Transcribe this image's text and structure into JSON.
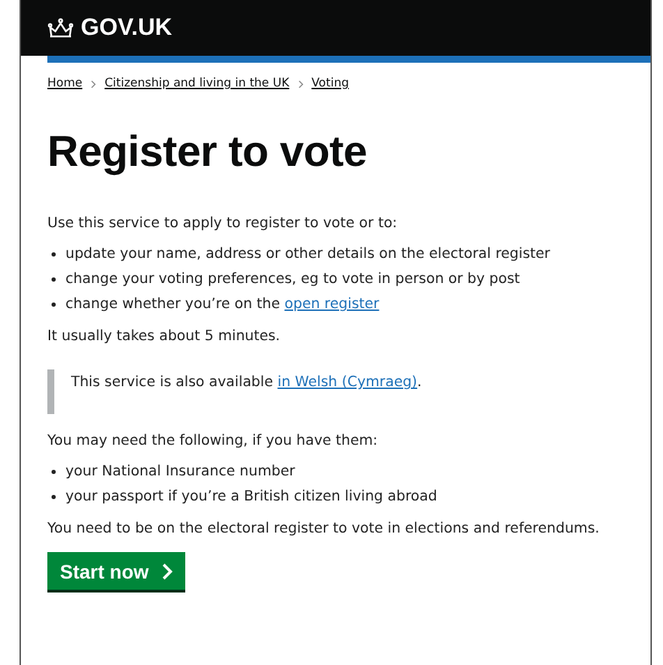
{
  "header": {
    "logo": "GOV.UK"
  },
  "breadcrumbs": [
    {
      "label": "Home"
    },
    {
      "label": "Citizenship and living in the UK"
    },
    {
      "label": "Voting"
    }
  ],
  "title": "Register to vote",
  "sections": [
    {
      "kind": "paragraph",
      "text": "Use this service to apply to register to vote or to:"
    },
    {
      "kind": "list",
      "items": [
        {
          "text": "update your name, address or other details on the electoral register"
        },
        {
          "text": "change your voting preferences, eg to vote in person or by post"
        },
        {
          "text": "change whether you’re on the ",
          "link": "open register"
        }
      ]
    },
    {
      "kind": "paragraph",
      "text": "It usually takes about 5 minutes."
    },
    {
      "kind": "inset",
      "text": "This service is also available ",
      "link": "in Welsh (Cymraeg)",
      "after": "."
    },
    {
      "kind": "paragraph",
      "text": "You may need the following, if you have them:"
    },
    {
      "kind": "list",
      "items": [
        {
          "text": "your National Insurance number"
        },
        {
          "text": "your passport if you’re a British citizen living abroad"
        }
      ]
    },
    {
      "kind": "paragraph",
      "text": "You need to be on the electoral register to vote in elections and referendums."
    }
  ],
  "start_button": {
    "label": "Start now"
  }
}
